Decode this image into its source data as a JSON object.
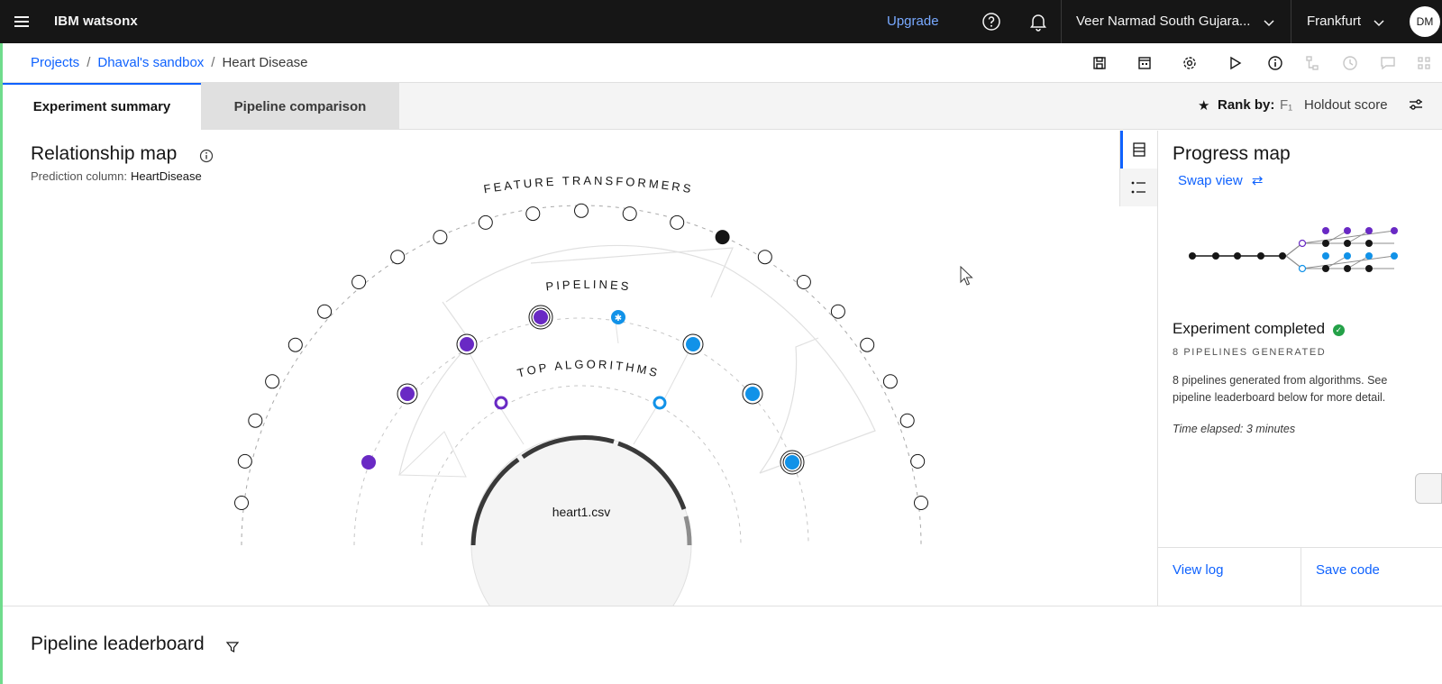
{
  "topbar": {
    "brand": "IBM watsonx",
    "upgrade_label": "Upgrade",
    "account": "Veer Narmad South Gujara...",
    "region": "Frankfurt",
    "avatar_initials": "DM"
  },
  "breadcrumb": {
    "items": [
      "Projects",
      "Dhaval's sandbox"
    ],
    "current": "Heart Disease"
  },
  "tabs": {
    "summary": "Experiment summary",
    "comparison": "Pipeline comparison"
  },
  "rank": {
    "label": "Rank by:",
    "metric": "F₁",
    "score": "Holdout score"
  },
  "relationship_map": {
    "title": "Relationship map",
    "prediction_label": "Prediction column:",
    "prediction_value": "HeartDisease",
    "ring_feature": "FEATURE TRANSFORMERS",
    "ring_pipelines": "PIPELINES",
    "ring_algorithms": "TOP ALGORITHMS",
    "dataset": "heart1.csv"
  },
  "progress_map": {
    "title": "Progress map",
    "swap_label": "Swap view",
    "status": "Experiment completed",
    "count": "8 PIPELINES GENERATED",
    "description": "8 pipelines generated from algorithms. See pipeline leaderboard below for more detail.",
    "time": "Time elapsed: 3 minutes",
    "view_log": "View log",
    "save_code": "Save code"
  },
  "leaderboard": {
    "title": "Pipeline leaderboard"
  },
  "colors": {
    "accent": "#0f62fe",
    "purple": "#6929c4",
    "cyan": "#1192e8",
    "success": "#24a148"
  }
}
